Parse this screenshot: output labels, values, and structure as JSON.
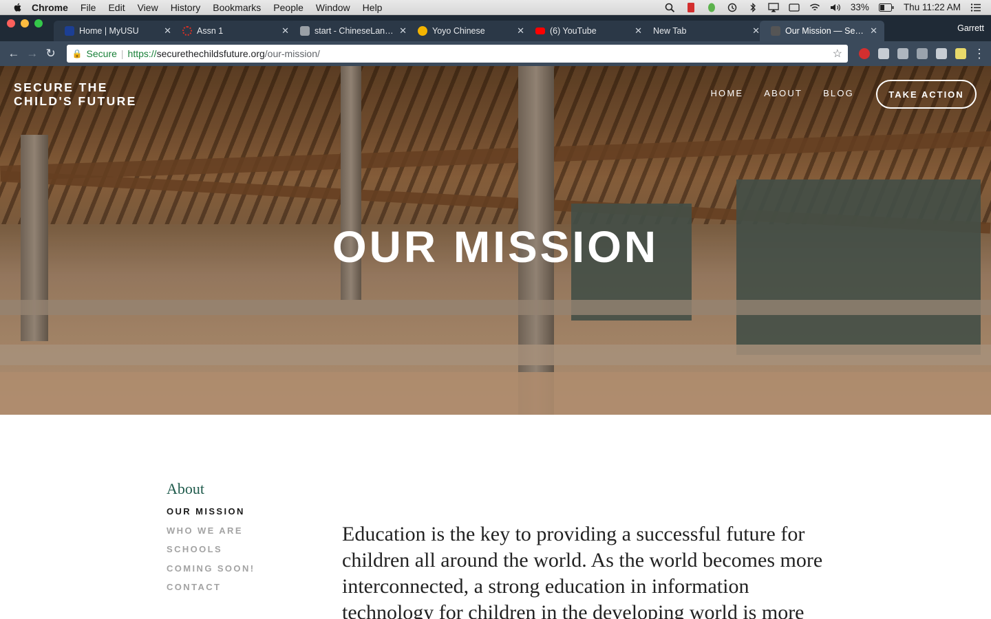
{
  "menubar": {
    "app": "Chrome",
    "items": [
      "File",
      "Edit",
      "View",
      "History",
      "Bookmarks",
      "People",
      "Window",
      "Help"
    ],
    "battery": "33%",
    "clock": "Thu 11:22 AM"
  },
  "tabs": [
    {
      "title": "Home | MyUSU",
      "color": "#1c3f94"
    },
    {
      "title": "Assn 1",
      "color": "#d93025"
    },
    {
      "title": "start - ChineseLanguage",
      "color": "#9aa0a6"
    },
    {
      "title": "Yoyo Chinese",
      "color": "#f4b400"
    },
    {
      "title": "(6) YouTube",
      "color": "#ff0000"
    },
    {
      "title": "New Tab",
      "color": ""
    },
    {
      "title": "Our Mission — Secure",
      "color": "#555555"
    }
  ],
  "profile_name": "Garrett",
  "address": {
    "secure_label": "Secure",
    "scheme": "https://",
    "host": "securethechildsfuture.org",
    "path": "/our-mission/"
  },
  "site": {
    "logo_line1": "SECURE THE",
    "logo_line2": "CHILD'S FUTURE",
    "nav": [
      "HOME",
      "ABOUT",
      "BLOG"
    ],
    "cta": "TAKE ACTION",
    "hero_title": "OUR MISSION"
  },
  "sidebar": {
    "heading": "About",
    "items": [
      {
        "label": "OUR MISSION",
        "active": true
      },
      {
        "label": "WHO WE ARE",
        "active": false
      },
      {
        "label": "SCHOOLS",
        "active": false
      },
      {
        "label": "COMING SOON!",
        "active": false
      },
      {
        "label": "CONTACT",
        "active": false
      }
    ]
  },
  "body_text": "Education is the key to providing a successful future for children all around the world. As the world becomes more interconnected, a strong education in information technology for children in the developing world is more"
}
